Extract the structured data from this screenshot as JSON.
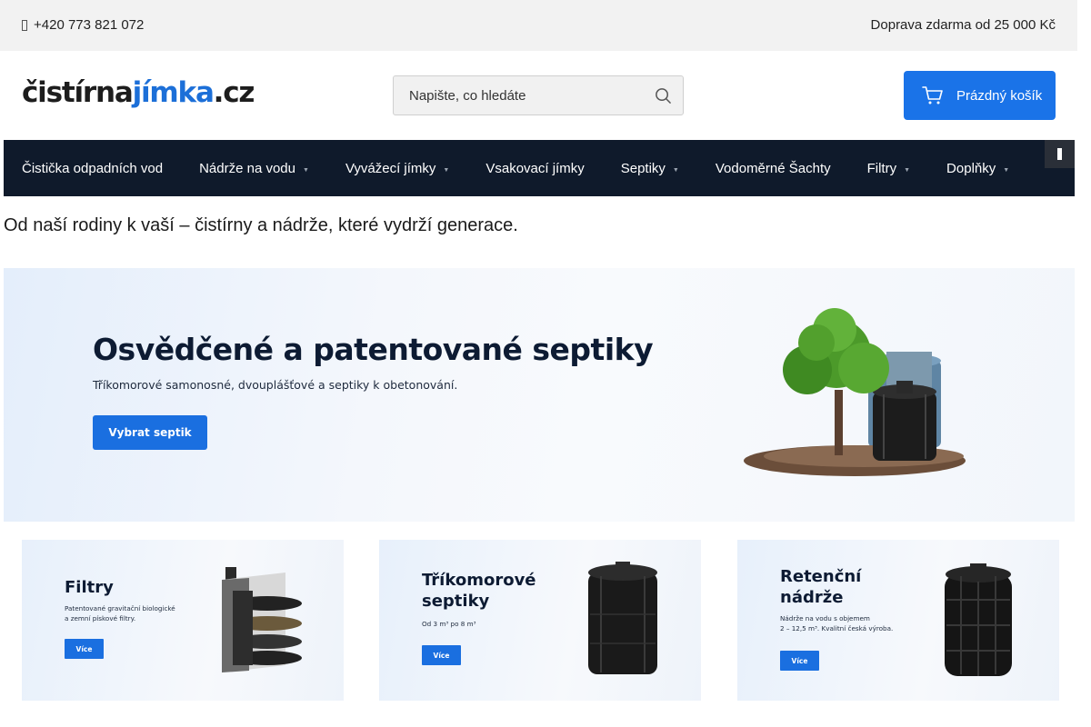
{
  "topbar": {
    "phone": "+420 773 821 072",
    "shipping": "Doprava zdarma od 25 000 Kč"
  },
  "logo": {
    "part1": "čistírna",
    "part2": "jímka",
    "part3": ".cz"
  },
  "search": {
    "placeholder": "Napište, co hledáte"
  },
  "cart": {
    "label": "Prázdný košík"
  },
  "nav": {
    "items": [
      {
        "label": "Čistička odpadních vod",
        "dropdown": false
      },
      {
        "label": "Nádrže na vodu",
        "dropdown": true
      },
      {
        "label": "Vyvážecí jímky",
        "dropdown": true
      },
      {
        "label": "Vsakovací jímky",
        "dropdown": false
      },
      {
        "label": "Septiky",
        "dropdown": true
      },
      {
        "label": "Vodoměrné Šachty",
        "dropdown": false
      },
      {
        "label": "Filtry",
        "dropdown": true
      },
      {
        "label": "Doplňky",
        "dropdown": true
      }
    ]
  },
  "tagline": "Od naší rodiny k vaší – čistírny a nádrže, které vydrží generace.",
  "hero": {
    "title": "Osvědčené a patentované septiky",
    "subtitle": "Tříkomorové samonosné, dvouplášťové a septiky k obetonování.",
    "button": "Vybrat septik"
  },
  "cards": [
    {
      "title": "Filtry",
      "text": "Patentované gravitační biologické\na zemní pískové filtry.",
      "button": "Více"
    },
    {
      "title": "Tříkomorové\nseptiky",
      "text": "Od 3 m³ po 8 m³",
      "button": "Více"
    },
    {
      "title": "Retenční\nnádrže",
      "text": "Nádrže na vodu s objemem\n2 – 12,5 m³. Kvalitní česká výroba.",
      "button": "Více"
    }
  ],
  "colors": {
    "accent": "#1a73e8",
    "nav_bg": "#0f1a2b",
    "topbar_bg": "#f2f2f2"
  }
}
